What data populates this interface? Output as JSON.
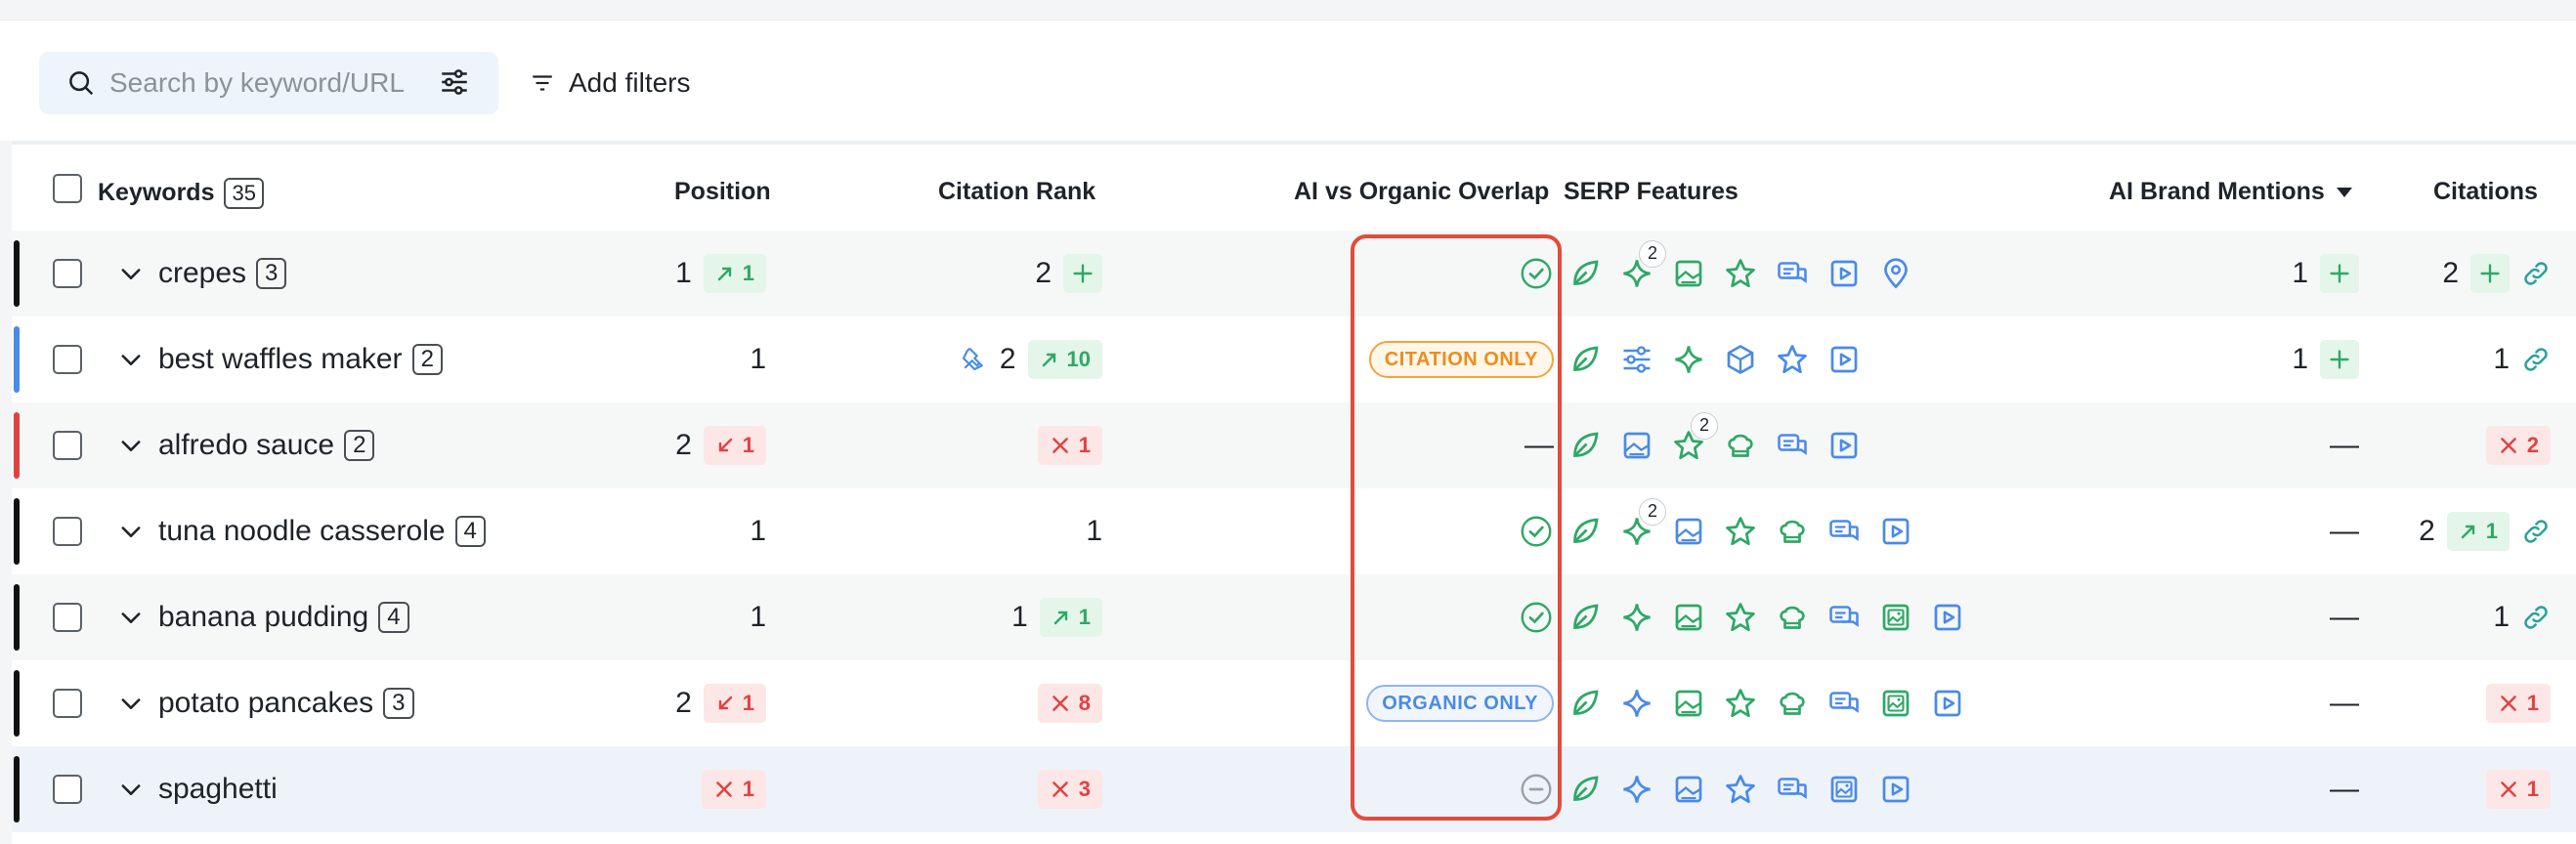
{
  "search": {
    "placeholder": "Search by keyword/URL"
  },
  "toolbar": {
    "add_filters_label": "Add filters"
  },
  "columns": {
    "keywords": "Keywords",
    "keywords_count": "35",
    "position": "Position",
    "citation_rank": "Citation Rank",
    "overlap": "AI vs Organic Overlap",
    "serp": "SERP Features",
    "mentions": "AI Brand Mentions",
    "citations": "Citations"
  },
  "rows": [
    {
      "keyword": "crepes",
      "count": "3",
      "bar_color": "#111111",
      "position": "1",
      "position_change": "1",
      "position_dir": "up",
      "citation_rank": "2",
      "citation_rank_change": "",
      "citation_rank_state": "new",
      "overlap": "check",
      "overlap_label": "",
      "serp": [
        "leaf-icon",
        "sparkle-icon:2",
        "image-card-icon",
        "star-icon",
        "chat-icon",
        "video-icon",
        "map-pin-icon"
      ],
      "mentions": "1",
      "mentions_state": "new",
      "citations": "2",
      "citations_state": "new",
      "citations_link": true
    },
    {
      "keyword": "best waffles maker",
      "count": "2",
      "bar_color": "#4a8ae8",
      "position": "1",
      "position_change": "",
      "position_dir": "",
      "citation_rank": "2",
      "citation_rank_change": "10",
      "citation_rank_state": "up",
      "citation_rank_pin": true,
      "overlap": "tag",
      "overlap_label": "CITATION ONLY",
      "serp": [
        "leaf-icon",
        "sliders-icon",
        "sparkle-icon",
        "cube-icon",
        "star-icon",
        "video-icon"
      ],
      "mentions": "1",
      "mentions_state": "new",
      "citations": "1",
      "citations_state": "",
      "citations_link": true
    },
    {
      "keyword": "alfredo sauce",
      "count": "2",
      "bar_color": "#e04242",
      "position": "2",
      "position_change": "1",
      "position_dir": "down",
      "citation_rank": "",
      "citation_rank_change": "1",
      "citation_rank_state": "lost",
      "overlap": "dash",
      "overlap_label": "—",
      "serp": [
        "leaf-icon",
        "image-card-icon",
        "star-icon:2",
        "chef-hat-icon",
        "chat-icon",
        "video-icon"
      ],
      "mentions": "—",
      "mentions_state": "",
      "citations": "2",
      "citations_state": "lost",
      "citations_link": false
    },
    {
      "keyword": "tuna noodle casserole",
      "count": "4",
      "bar_color": "#111111",
      "position": "1",
      "position_change": "",
      "position_dir": "",
      "citation_rank": "1",
      "citation_rank_change": "",
      "citation_rank_state": "",
      "overlap": "check",
      "overlap_label": "",
      "serp": [
        "leaf-icon",
        "sparkle-icon:2",
        "image-card-icon",
        "star-icon",
        "chef-hat-icon",
        "chat-icon",
        "video-icon"
      ],
      "mentions": "—",
      "mentions_state": "",
      "citations": "2",
      "citations_change": "1",
      "citations_state": "up",
      "citations_link": true
    },
    {
      "keyword": "banana pudding",
      "count": "4",
      "bar_color": "#111111",
      "position": "1",
      "position_change": "",
      "position_dir": "",
      "citation_rank": "1",
      "citation_rank_change": "1",
      "citation_rank_state": "up",
      "overlap": "check",
      "overlap_label": "",
      "serp": [
        "leaf-icon",
        "sparkle-icon",
        "image-card-icon",
        "star-icon",
        "chef-hat-icon",
        "chat-icon",
        "gallery-icon",
        "video-icon"
      ],
      "mentions": "—",
      "mentions_state": "",
      "citations": "1",
      "citations_state": "",
      "citations_link": true
    },
    {
      "keyword": "potato pancakes",
      "count": "3",
      "bar_color": "#111111",
      "position": "2",
      "position_change": "1",
      "position_dir": "down",
      "citation_rank": "",
      "citation_rank_change": "8",
      "citation_rank_state": "lost",
      "overlap": "tag",
      "overlap_label": "ORGANIC ONLY",
      "serp": [
        "leaf-icon",
        "sparkle-icon",
        "image-card-icon",
        "star-icon",
        "chef-hat-icon",
        "chat-icon",
        "gallery-icon",
        "video-icon"
      ],
      "mentions": "—",
      "mentions_state": "",
      "citations": "1",
      "citations_state": "lost",
      "citations_link": false
    },
    {
      "keyword": "spaghetti",
      "count": "",
      "bar_color": "#111111",
      "position": "",
      "position_change": "1",
      "position_dir": "lost",
      "citation_rank": "",
      "citation_rank_change": "3",
      "citation_rank_state": "lost",
      "overlap": "minus",
      "overlap_label": "",
      "serp": [
        "leaf-icon",
        "sparkle-icon",
        "image-card-icon",
        "star-icon",
        "chat-icon",
        "gallery-icon",
        "video-icon"
      ],
      "mentions": "—",
      "mentions_state": "",
      "citations": "1",
      "citations_state": "lost",
      "citations_link": false
    }
  ],
  "colors": {
    "green": "#2fa866",
    "blue": "#4a8ae8",
    "red": "#e04242",
    "orange": "#f08c1a",
    "highlight": "#e34b3b"
  }
}
